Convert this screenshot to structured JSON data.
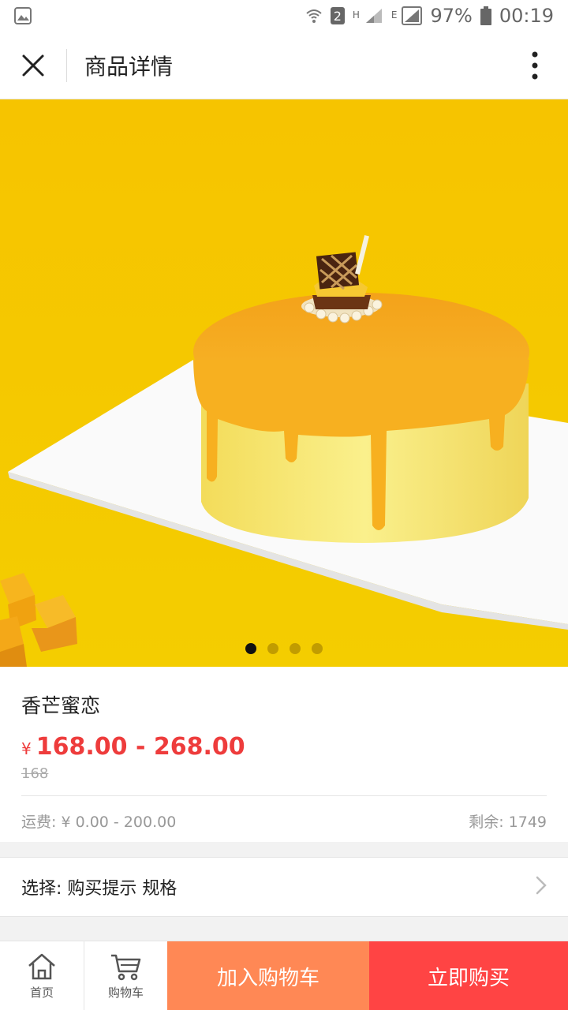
{
  "status_bar": {
    "battery_percent": "97%",
    "time": "00:19",
    "sim_badge": "2",
    "network_h": "H",
    "network_e": "E"
  },
  "header": {
    "title": "商品详情"
  },
  "product": {
    "name": "香芒蜜恋",
    "currency": "¥",
    "price_range": "168.00 - 268.00",
    "original_price": "168",
    "shipping": "运费: ¥ 0.00 - 200.00",
    "stock": "剩余: 1749",
    "image_pager": {
      "total": 4,
      "active": 0
    }
  },
  "option_row": {
    "label": "选择: 购买提示 规格"
  },
  "bottom_bar": {
    "home_label": "首页",
    "cart_label": "购物车",
    "add_to_cart_label": "加入购物车",
    "buy_now_label": "立即购买"
  },
  "colors": {
    "accent_red": "#ee3c3c",
    "add_cart_bg": "#ff8855",
    "buy_now_bg": "#ff4444",
    "image_bg": "#f5c800"
  },
  "icons": [
    "close-icon",
    "more-vertical-icon",
    "home-icon",
    "cart-icon",
    "chevron-right-icon",
    "gallery-icon",
    "wifi-icon",
    "signal-icon",
    "battery-icon"
  ]
}
